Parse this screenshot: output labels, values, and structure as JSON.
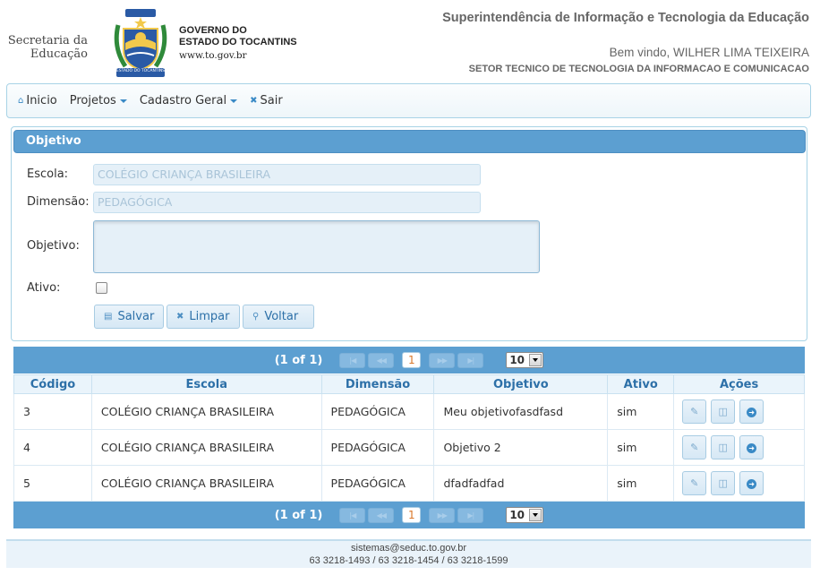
{
  "header": {
    "secretaria": "Secretaria da Educação",
    "gov_line1": "GOVERNO DO",
    "gov_line2": "ESTADO DO TOCANTINS",
    "gov_url": "www.to.gov.br",
    "seal_text": "ESTADO DO TOCANTINS",
    "superintendencia": "Superintendência de Informação e Tecnologia da Educação",
    "welcome": "Bem vindo, WILHER LIMA TEIXEIRA",
    "sector": "SETOR TECNICO DE TECNOLOGIA DA INFORMACAO E COMUNICACAO"
  },
  "menu": {
    "home": "Inicio",
    "projetos": "Projetos",
    "cadastro": "Cadastro Geral",
    "sair": "Sair"
  },
  "form": {
    "title": "Objetivo",
    "escola_label": "Escola:",
    "escola_value": "COLÉGIO CRIANÇA BRASILEIRA",
    "dimensao_label": "Dimensão:",
    "dimensao_value": "PEDAGÓGICA",
    "objetivo_label": "Objetivo:",
    "objetivo_value": "",
    "ativo_label": "Ativo:",
    "ativo_checked": false,
    "salvar": "Salvar",
    "limpar": "Limpar",
    "voltar": "Voltar"
  },
  "pager": {
    "info": "(1 of 1)",
    "current_page": "1",
    "rows_per_page": "10"
  },
  "table": {
    "columns": [
      "Código",
      "Escola",
      "Dimensão",
      "Objetivo",
      "Ativo",
      "Ações"
    ],
    "rows": [
      {
        "codigo": "3",
        "escola": "COLÉGIO CRIANÇA BRASILEIRA",
        "dimensao": "PEDAGÓGICA",
        "objetivo": "Meu objetivofasdfasd",
        "ativo": "sim"
      },
      {
        "codigo": "4",
        "escola": "COLÉGIO CRIANÇA BRASILEIRA",
        "dimensao": "PEDAGÓGICA",
        "objetivo": "Objetivo 2",
        "ativo": "sim"
      },
      {
        "codigo": "5",
        "escola": "COLÉGIO CRIANÇA BRASILEIRA",
        "dimensao": "PEDAGÓGICA",
        "objetivo": "dfadfadfad",
        "ativo": "sim"
      }
    ]
  },
  "footer": {
    "email": "sistemas@seduc.to.gov.br",
    "phones": "63 3218-1493 / 63 3218-1454 / 63 3218-1599"
  },
  "colors": {
    "accent": "#5c9fd1",
    "link": "#2d70a8",
    "field_bg": "#e5f0f8",
    "page_number": "#d9772a"
  },
  "icons": {
    "home": "home-icon",
    "close": "close-icon",
    "save": "disk-icon",
    "clear": "close-icon",
    "back": "search-icon",
    "edit": "pencil-icon",
    "delete": "trash-icon",
    "go": "arrow-right-circle-icon"
  }
}
